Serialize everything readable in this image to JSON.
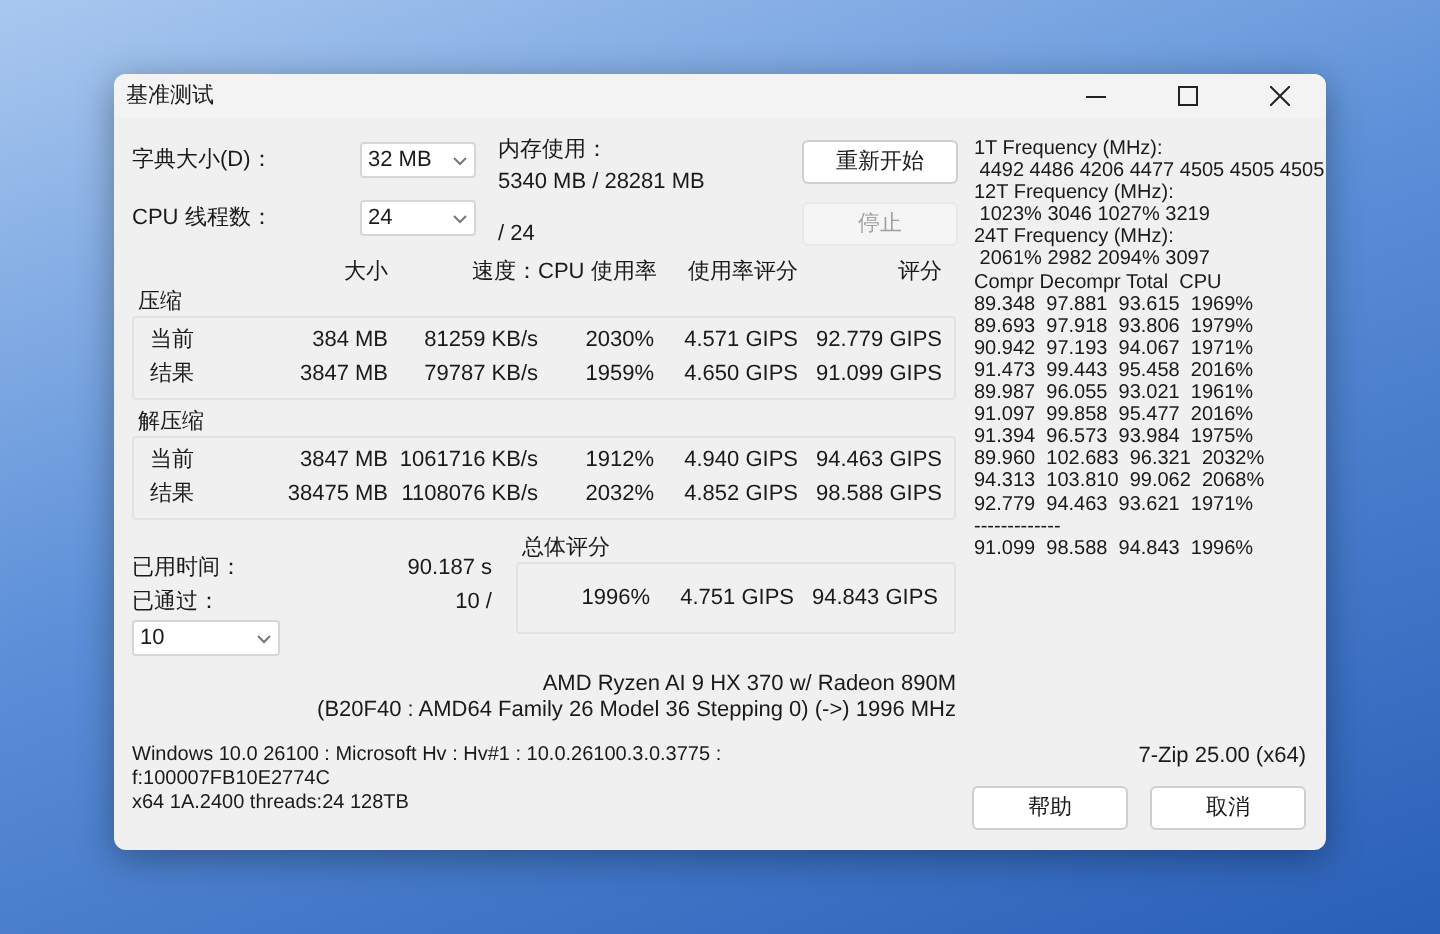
{
  "window": {
    "title": "基准测试"
  },
  "settings": {
    "dictionary": {
      "label": "字典大小(D)：",
      "value": "32 MB"
    },
    "threads": {
      "label": "CPU 线程数：",
      "value": "24",
      "max": "/ 24"
    },
    "memory": {
      "label": "内存使用：",
      "value": "5340 MB / 28281 MB"
    }
  },
  "buttons": [
    {
      "label": "重新开始",
      "disabled": false
    },
    {
      "label": "停止",
      "disabled": true
    }
  ],
  "table": {
    "columns": [
      "大小",
      "速度：",
      "CPU 使用率",
      "使用率评分",
      "评分"
    ],
    "groups": [
      {
        "title": "压缩",
        "rows": [
          {
            "label": "当前",
            "cells": [
              "384 MB",
              "81259 KB/s",
              "2030%",
              "4.571 GIPS",
              "92.779 GIPS"
            ]
          },
          {
            "label": "结果",
            "cells": [
              "3847 MB",
              "79787 KB/s",
              "1959%",
              "4.650 GIPS",
              "91.099 GIPS"
            ]
          }
        ]
      },
      {
        "title": "解压缩",
        "rows": [
          {
            "label": "当前",
            "cells": [
              "3847 MB",
              "1061716 KB/s",
              "1912%",
              "4.940 GIPS",
              "94.463 GIPS"
            ]
          },
          {
            "label": "结果",
            "cells": [
              "38475 MB",
              "1108076 KB/s",
              "2032%",
              "4.852 GIPS",
              "98.588 GIPS"
            ]
          }
        ]
      }
    ]
  },
  "summary": {
    "elapsed_label": "已用时间：",
    "elapsed": "90.187 s",
    "passes_label": "已通过：",
    "passes": "10 /",
    "passes_select": "10",
    "total": {
      "title": "总体评分",
      "cells": [
        "1996%",
        "4.751 GIPS",
        "94.843 GIPS"
      ]
    }
  },
  "cpu": [
    "AMD Ryzen AI 9 HX 370 w/ Radeon 890M",
    "(B20F40 : AMD64 Family 26 Model 36 Stepping 0) (->) 1996 MHz"
  ],
  "system": {
    "lines": [
      "Windows 10.0 26100 : Microsoft Hv : Hv#1 : 10.0.26100.3.0.3775 :",
      "f:100007FB10E2774C",
      "x64 1A.2400 threads:24 128TB"
    ],
    "version": "7-Zip 25.00 (x64)"
  },
  "footer_buttons": [
    "帮助",
    "取消"
  ],
  "log": [
    "1T Frequency (MHz):",
    " 4492 4486 4206 4477 4505 4505 4505",
    "12T Frequency (MHz):",
    " 1023% 3046 1027% 3219",
    "24T Frequency (MHz):",
    " 2061% 2982 2094% 3097",
    "Compr Decompr Total  CPU",
    "89.348  97.881  93.615  1969%",
    "89.693  97.918  93.806  1979%",
    "90.942  97.193  94.067  1971%",
    "91.473  99.443  95.458  2016%",
    "89.987  96.055  93.021  1961%",
    "91.097  99.858  95.477  2016%",
    "91.394  96.573  93.984  1975%",
    "89.960  102.683  96.321  2032%",
    "94.313  103.810  99.062  2068%",
    "92.779  94.463  93.621  1971%",
    "-------------",
    "91.099  98.588  94.843  1996%"
  ]
}
